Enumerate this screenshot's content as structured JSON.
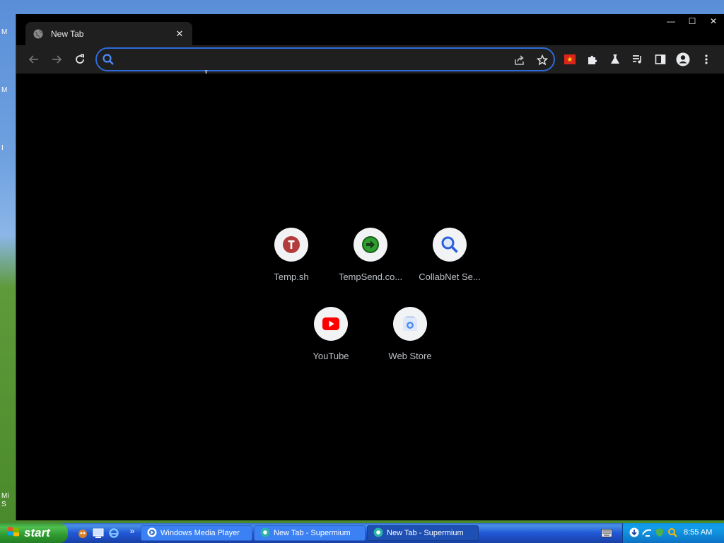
{
  "desktop": {
    "edge_labels": [
      "M",
      "M",
      "I",
      "Mi",
      "S"
    ]
  },
  "browser": {
    "tab": {
      "title": "New Tab",
      "close_icon": "close-icon"
    },
    "window_controls": {
      "minimize": "—",
      "maximize": "☐",
      "close": "✕"
    },
    "omnibox": {
      "value": "",
      "placeholder": ""
    },
    "colors": {
      "accent": "#2f6bd8",
      "background": "#000000",
      "toolbar": "#1f1f1f"
    }
  },
  "shortcuts": [
    {
      "label": "Temp.sh",
      "icon": "temp-sh-icon"
    },
    {
      "label": "TempSend.co...",
      "icon": "tempsend-icon"
    },
    {
      "label": "CollabNet Se...",
      "icon": "search-icon"
    },
    {
      "label": "YouTube",
      "icon": "youtube-icon"
    },
    {
      "label": "Web Store",
      "icon": "web-store-icon"
    }
  ],
  "taskbar": {
    "start_label": "start",
    "tasks": [
      {
        "label": "Windows Media Player",
        "active": false
      },
      {
        "label": "New Tab - Supermium",
        "active": false
      },
      {
        "label": "New Tab - Supermium",
        "active": true
      }
    ],
    "chevron": "»",
    "clock": "8:55 AM"
  }
}
